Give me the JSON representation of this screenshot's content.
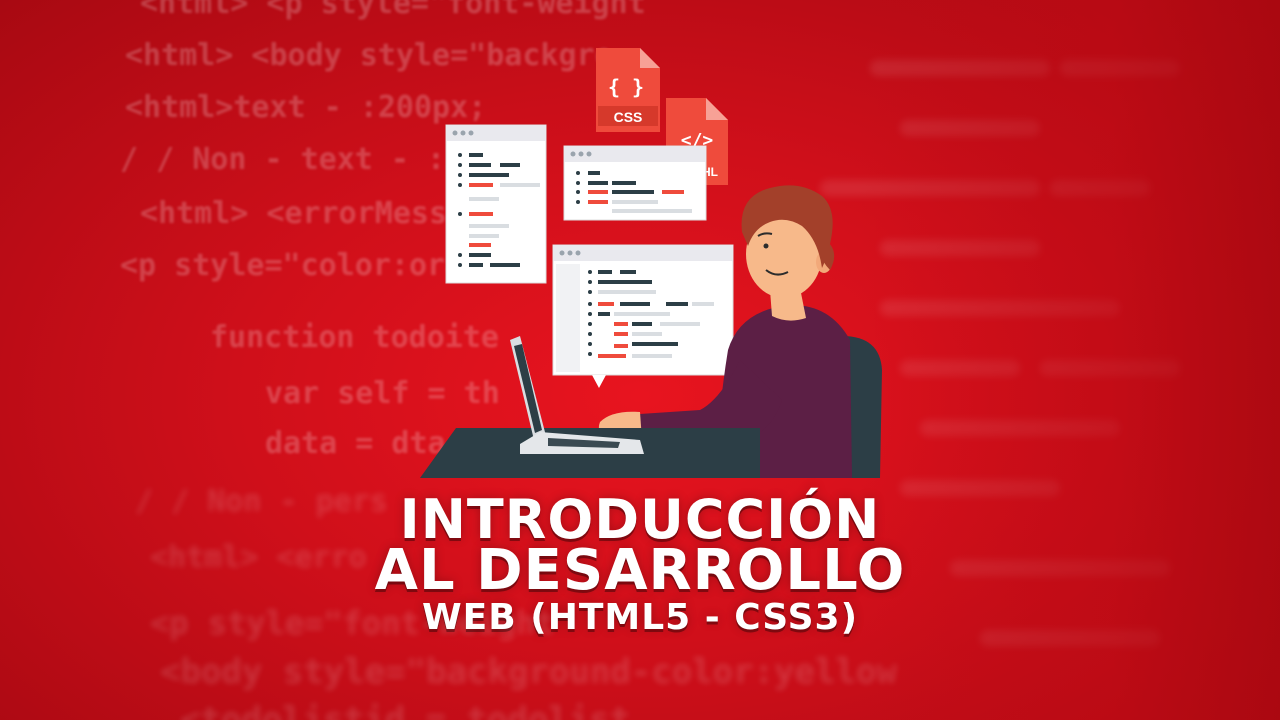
{
  "background_code": {
    "lines": [
      "<html> <p style=\"font-weight",
      "<html> <body style=\"backgro",
      "<html>text - :200px;",
      "/ / Non - text - :20",
      "<html> <errorMess",
      "<p style=\"color:orange;",
      "function   todoite",
      "var   self = th",
      "data = dta",
      "/ / Non - pers",
      "<html> <erro",
      "<p style=\"font-weight",
      "<body style=\"background-color:yellow",
      "<todolistid = todolist"
    ]
  },
  "icons": {
    "css_label": "CSS",
    "css_symbol": "{ }",
    "html_symbol": "</>",
    "html_label": "HL"
  },
  "title": {
    "line1": "INTRODUCCIÓN",
    "line2": "AL DESARROLLO",
    "line3": "WEB (HTML5 - CSS3)"
  },
  "colors": {
    "background": "#d0101b",
    "file_icon": "#ef4b3c",
    "shirt": "#5c1f45",
    "desk": "#2c3e46",
    "hair": "#a3402a"
  }
}
